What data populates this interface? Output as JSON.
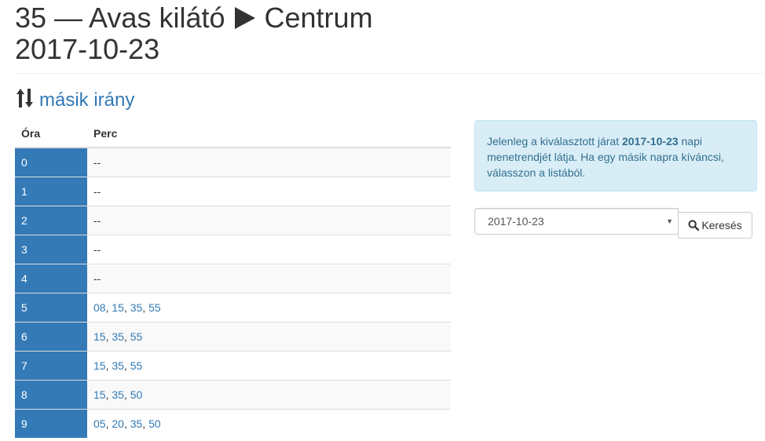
{
  "header": {
    "title_line1_from": "35 — Avas kilátó",
    "title_line1_to": "Centrum",
    "title_line2": "2017-10-23",
    "direction_icon": "sort-arrows-icon",
    "arrow_icon": "play-icon"
  },
  "direction_link": {
    "label": "másik irány"
  },
  "table": {
    "col_hour": "Óra",
    "col_minute": "Perc",
    "rows": [
      {
        "hour": "0",
        "minutes": []
      },
      {
        "hour": "1",
        "minutes": []
      },
      {
        "hour": "2",
        "minutes": []
      },
      {
        "hour": "3",
        "minutes": []
      },
      {
        "hour": "4",
        "minutes": []
      },
      {
        "hour": "5",
        "minutes": [
          "08",
          "15",
          "35",
          "55"
        ]
      },
      {
        "hour": "6",
        "minutes": [
          "15",
          "35",
          "55"
        ]
      },
      {
        "hour": "7",
        "minutes": [
          "15",
          "35",
          "55"
        ]
      },
      {
        "hour": "8",
        "minutes": [
          "15",
          "35",
          "50"
        ]
      },
      {
        "hour": "9",
        "minutes": [
          "05",
          "20",
          "35",
          "50"
        ]
      }
    ],
    "empty_marker": "--"
  },
  "info": {
    "text_before": "Jelenleg a kiválasztott járat ",
    "date": "2017-10-23",
    "text_after": " napi menetrendjét látja. Ha egy másik napra kíváncsi, válasszon a listából."
  },
  "form": {
    "selected_date": "2017-10-23",
    "search_label": "Keresés",
    "search_icon": "search-icon"
  },
  "colors": {
    "hour_cell_bg": "#337ab7",
    "link": "#337ab7",
    "info_bg": "#d9edf7",
    "info_text": "#31708f"
  }
}
